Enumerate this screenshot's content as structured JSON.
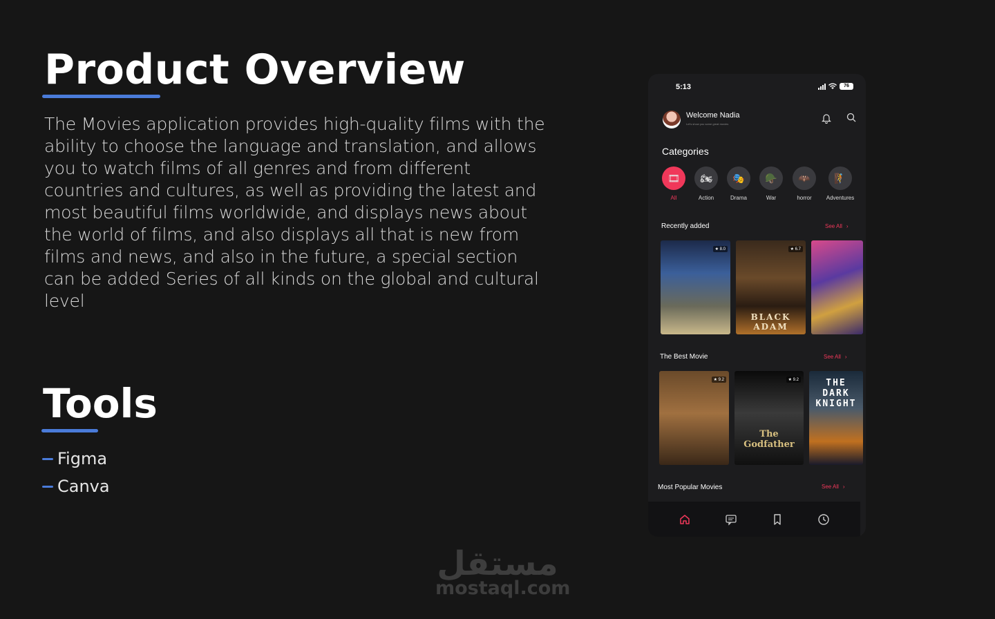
{
  "overview": {
    "title": "Product Overview",
    "paragraph": "The Movies application provides high-quality films with the ability to choose the language and translation, and allows you to watch films of all genres and from different countries and cultures, as well as providing the latest and most beautiful films worldwide, and displays news about the world of films, and also displays all that is new from films and news, and also in the future, a special section can be added Series of all kinds on the global and cultural level"
  },
  "tools": {
    "title": "Tools",
    "items": [
      "Figma",
      "Canva"
    ]
  },
  "watermark": {
    "arabic": "مستقل",
    "latin": "mostaql.com"
  },
  "phone": {
    "status_time": "5:13",
    "battery": "76",
    "welcome": "Welcome Nadia",
    "welcome_sub": "Let's show you some great movies",
    "categories_title": "Categories",
    "categories": [
      {
        "label": "All",
        "icon": "all-icon",
        "active": true
      },
      {
        "label": "Action",
        "icon": "action-icon",
        "active": false
      },
      {
        "label": "Drama",
        "icon": "drama-icon",
        "active": false
      },
      {
        "label": "War",
        "icon": "war-icon",
        "active": false
      },
      {
        "label": "horror",
        "icon": "horror-icon",
        "active": false
      },
      {
        "label": "Adventures",
        "icon": "adventures-icon",
        "active": false
      }
    ],
    "recently_added": {
      "title": "Recently added",
      "see_all": "See All",
      "posters": [
        {
          "rating": "8.0"
        },
        {
          "rating": "6.7",
          "text": "BLACK ADAM"
        },
        {}
      ]
    },
    "best_movie": {
      "title": "The Best Movie",
      "see_all": "See All",
      "posters": [
        {
          "rating": "9.2"
        },
        {
          "rating": "9.2",
          "text": "The Godfather"
        },
        {
          "text": "THE DARK KNIGHT"
        }
      ]
    },
    "popular": {
      "title": "Most Popular Movies",
      "see_all": "See All"
    },
    "nav": [
      "home-icon",
      "news-icon",
      "bookmark-icon",
      "history-icon"
    ],
    "accent": "#f0385a"
  }
}
